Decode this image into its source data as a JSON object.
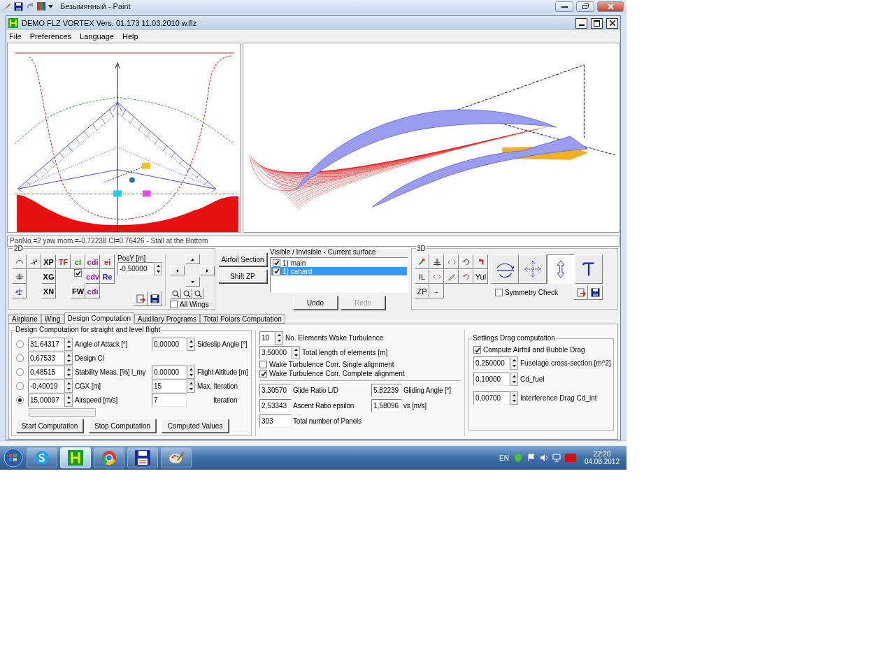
{
  "paint_window": {
    "title": "Безымянный - Paint"
  },
  "window": {
    "title": "DEMO FLZ VORTEX Vers. 01.173 11.03.2010 w.flz"
  },
  "menu": [
    "File",
    "Preferences",
    "Language",
    "Help"
  ],
  "status_line": "PanNo.=2 yaw mom.=-0.72238 Cl=0.76426 - Stall at the Bottom",
  "panel_2d": {
    "title": "2D",
    "rows": [
      [
        {
          "kind": "icon"
        },
        {
          "kind": "icon"
        },
        {
          "kind": "text",
          "label": "XP",
          "color": "#000000"
        },
        {
          "kind": "text",
          "label": "TF",
          "color": "#d02020"
        },
        {
          "kind": "text",
          "label": "cl",
          "color": "#208020"
        },
        {
          "kind": "text",
          "label": "cdi",
          "color": "#902090"
        },
        {
          "kind": "text",
          "label": "ei",
          "color": "#c02020"
        }
      ],
      [
        {
          "kind": "icon"
        },
        {
          "kind": "gap"
        },
        {
          "kind": "text",
          "label": "XG",
          "color": "#000000"
        },
        {
          "kind": "gap"
        },
        {
          "kind": "check",
          "checked": true
        },
        {
          "kind": "text",
          "label": "cdv",
          "color": "#902090"
        },
        {
          "kind": "text",
          "label": "Re",
          "color": "#2030a0"
        }
      ],
      [
        {
          "kind": "icon"
        },
        {
          "kind": "gap"
        },
        {
          "kind": "text",
          "label": "XN",
          "color": "#000000"
        },
        {
          "kind": "gap"
        },
        {
          "kind": "text",
          "label": "FW",
          "color": "#000000"
        },
        {
          "kind": "text",
          "label": "cdi",
          "color": "#902090"
        },
        {
          "kind": "gap"
        }
      ]
    ],
    "pos_y": {
      "label": "PosY [m]",
      "value": "-0,50000"
    },
    "all_wings": {
      "label": "All Wings",
      "checked": false
    }
  },
  "airfoil_buttons": [
    "Airfoil Section",
    "Shift ZP"
  ],
  "surfaces": {
    "title": "Visible / Invisible - Current surface",
    "items": [
      {
        "label": "1) main",
        "checked": true,
        "selected": false
      },
      {
        "label": "1) canard",
        "checked": true,
        "selected": true
      }
    ],
    "undo": {
      "label": "Undo",
      "disabled": false
    },
    "redo": {
      "label": "Redo",
      "disabled": true
    }
  },
  "panel_3d": {
    "title": "3D",
    "rows": [
      [
        {
          "kind": "icon"
        },
        {
          "kind": "icon"
        },
        {
          "kind": "icon"
        },
        {
          "kind": "icon"
        },
        {
          "kind": "icon"
        }
      ],
      [
        {
          "kind": "text",
          "label": "IL"
        },
        {
          "kind": "icon"
        },
        {
          "kind": "icon"
        },
        {
          "kind": "icon"
        },
        {
          "kind": "text",
          "label": "Yul"
        }
      ],
      [
        {
          "kind": "text",
          "label": "ZP"
        },
        {
          "kind": "text",
          "label": "-"
        }
      ]
    ],
    "big_buttons": [
      {
        "selected": false
      },
      {
        "selected": false
      },
      {
        "selected": true
      },
      {
        "selected": false
      }
    ],
    "symmetry_check": {
      "label": "Symmetry Check",
      "checked": false
    }
  },
  "tabs": [
    {
      "label": "Airplane",
      "selected": false
    },
    {
      "label": "Wing",
      "selected": false
    },
    {
      "label": "Design Computation",
      "selected": true
    },
    {
      "label": "Auxiliary Programs",
      "selected": false
    },
    {
      "label": "Total Polars Computation",
      "selected": false
    }
  ],
  "design": {
    "title": "Design Computation for straight and level flight",
    "rows": [
      {
        "selected": false,
        "value": "31,64317",
        "label": "Angle of Attack [°]"
      },
      {
        "selected": false,
        "value": "0,67533",
        "label": "Design Cl"
      },
      {
        "selected": false,
        "value": "0,48515",
        "label": "Stability Meas. [%] l_my"
      },
      {
        "selected": false,
        "value": "-0,40019",
        "label": "CGX [m]"
      },
      {
        "selected": true,
        "value": "15,00097",
        "label": "Airspeed [m/s]"
      }
    ],
    "right_rows": [
      {
        "kind": "spin",
        "value": "0,00000",
        "label": "Sideslip Angle [°]"
      },
      {
        "kind": "none"
      },
      {
        "kind": "spin",
        "value": "0.00000",
        "label": "Flight Altitude [m]"
      },
      {
        "kind": "spin",
        "value": "15",
        "label": "Max. Iteration"
      },
      {
        "kind": "plain",
        "value": "7",
        "label": "Iteration"
      }
    ],
    "buttons": [
      "Start Computation",
      "Stop Computation",
      "Computed Values"
    ]
  },
  "wake": {
    "elements": {
      "value": "10",
      "label": "No. Elements Wake Turbulence"
    },
    "length": {
      "value": "3,50000",
      "label": "Total length of elements [m]"
    },
    "options": [
      {
        "label": "Wake Turbulence Corr. Single alignment",
        "checked": false
      },
      {
        "label": "Wake Turbulence Corr. Complete alignment",
        "checked": true
      }
    ],
    "results": [
      [
        {
          "value": "3,30570",
          "label": "Glide Ratio L/D"
        },
        {
          "value": "5,82239",
          "label": "Gliding Angle [°]"
        }
      ],
      [
        {
          "value": "2,53343",
          "label": "Ascent Ratio epsilon"
        },
        {
          "value": "1,58096",
          "label": "vs [m/s]"
        }
      ],
      [
        {
          "value": "303",
          "label": "Total number of Panels"
        }
      ]
    ]
  },
  "drag": {
    "title": "Settings Drag computation",
    "option": {
      "label": "Compute Airfoil and Bubble Drag",
      "checked": true
    },
    "fields": [
      {
        "value": "0,250000",
        "label": "Fuselage cross-section [m^2]"
      },
      {
        "value": "0,10000",
        "label": "Cd_fuel"
      },
      {
        "value": "0,00700",
        "label": "Interference Drag Cd_int"
      }
    ]
  },
  "taskbar": {
    "apps": [
      {
        "selected": false
      },
      {
        "selected": true
      },
      {
        "selected": false
      },
      {
        "selected": false
      },
      {
        "selected": false
      }
    ],
    "language": "EN",
    "time": "22:20",
    "date": "04.08.2012"
  }
}
